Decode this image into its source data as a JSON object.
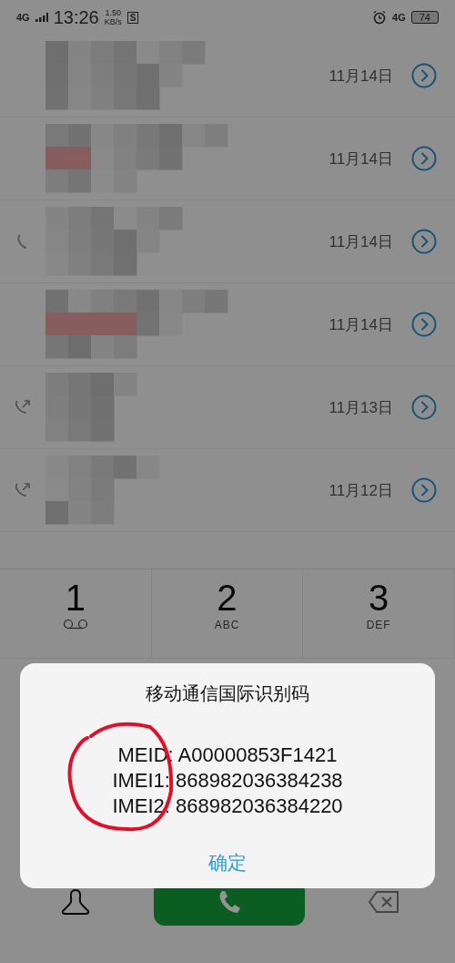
{
  "status_bar": {
    "network": "4G",
    "time": "13:26",
    "speed_value": "1.50",
    "speed_unit": "KB/s",
    "app_badge": "S",
    "network_right": "4G",
    "battery": "74"
  },
  "call_log": [
    {
      "kind": "none",
      "date": "11月14日"
    },
    {
      "kind": "none",
      "date": "11月14日"
    },
    {
      "kind": "incoming",
      "date": "11月14日"
    },
    {
      "kind": "none",
      "date": "11月14日"
    },
    {
      "kind": "outgoing",
      "date": "11月13日"
    },
    {
      "kind": "outgoing",
      "date": "11月12日"
    }
  ],
  "keypad": [
    {
      "digit": "1",
      "kind": "voicemail"
    },
    {
      "digit": "2",
      "kind": "letters",
      "letters": "ABC"
    },
    {
      "digit": "3",
      "kind": "letters",
      "letters": "DEF"
    }
  ],
  "dialog": {
    "title": "移动通信国际识别码",
    "lines": [
      "MEID: A00000853F1421",
      "IMEI1: 868982036384238",
      "IMEI2: 868982036384220"
    ],
    "button": "确定",
    "circled": true
  }
}
